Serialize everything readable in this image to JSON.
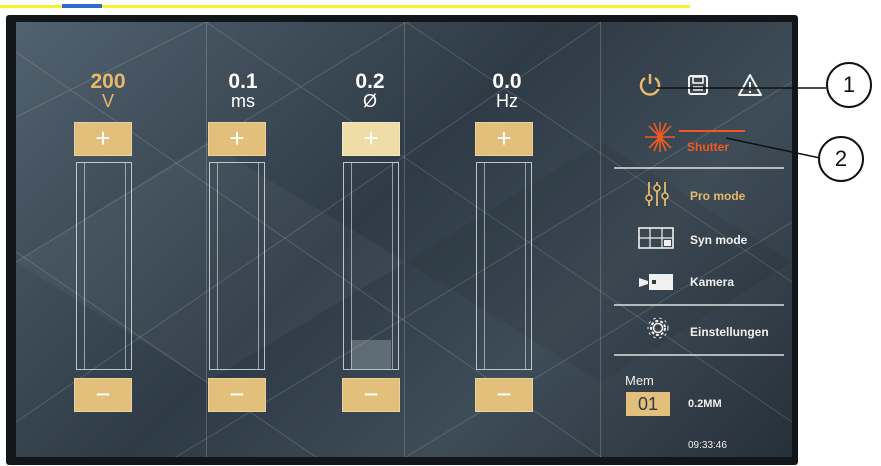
{
  "controls": [
    {
      "value": "200",
      "unit": "V",
      "fill": 0.0
    },
    {
      "value": "0.1",
      "unit": "ms",
      "fill": 0.0
    },
    {
      "value": "0.2",
      "unit": "Ø",
      "fill": 0.14
    },
    {
      "value": "0.0",
      "unit": "Hz",
      "fill": 0.0
    }
  ],
  "buttons": {
    "plus": "+",
    "minus": "−"
  },
  "toolbar": {
    "icons": [
      "power-icon",
      "save-icon",
      "warning-icon"
    ]
  },
  "shutter": {
    "label": "Shutter",
    "color": "#f05a22"
  },
  "menu": {
    "pro_mode": "Pro mode",
    "syn_mode": "Syn mode",
    "camera": "Kamera",
    "settings": "Einstellungen"
  },
  "memory": {
    "label": "Mem",
    "slot": "01",
    "value": "0.2MM"
  },
  "clock": "09:33:46",
  "callouts": [
    "1",
    "2"
  ],
  "colors": {
    "accent": "#e2c07b",
    "accent_text": "#e7b96a",
    "shutter": "#f05a22"
  }
}
